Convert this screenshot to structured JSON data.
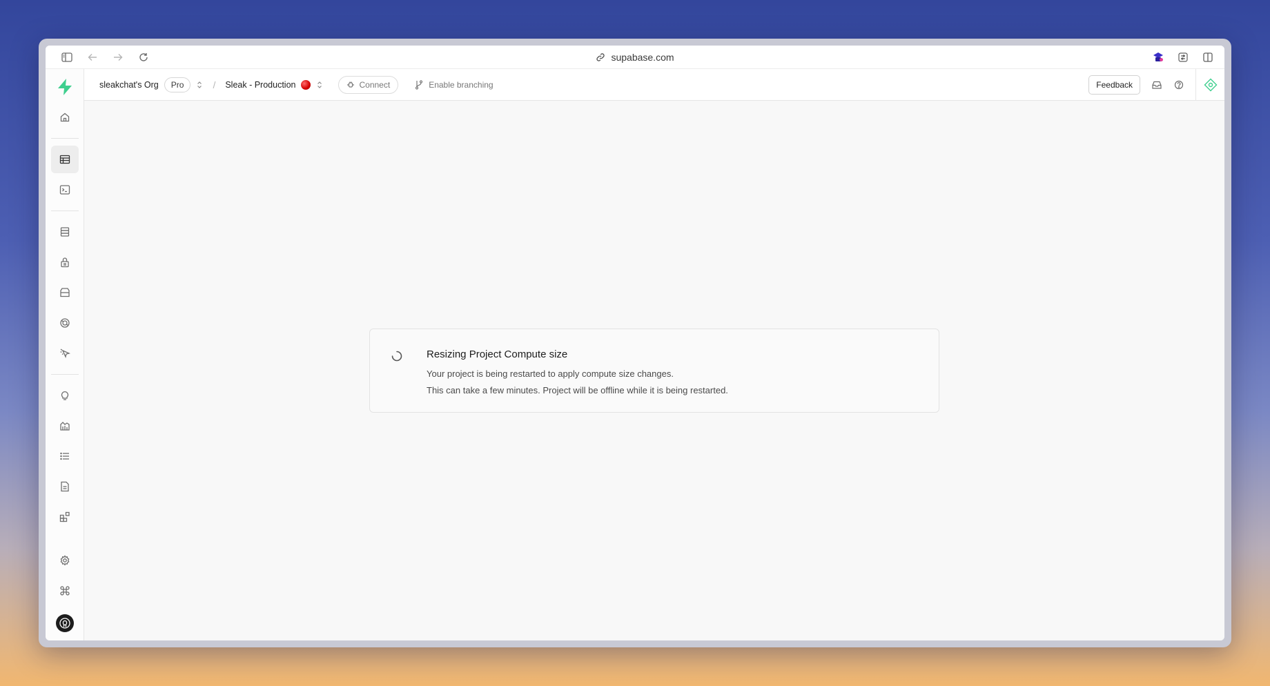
{
  "browser": {
    "url": "supabase.com"
  },
  "topbar": {
    "org_name": "sleakchat's Org",
    "plan_badge": "Pro",
    "project_name": "Sleak - Production",
    "connect_label": "Connect",
    "branching_label": "Enable branching",
    "feedback_label": "Feedback"
  },
  "sidebar": {
    "items": [
      {
        "icon": "home-icon"
      },
      {
        "icon": "table-editor-icon",
        "active": true
      },
      {
        "icon": "sql-editor-icon"
      },
      {
        "icon": "database-icon"
      },
      {
        "icon": "auth-lock-icon"
      },
      {
        "icon": "storage-icon"
      },
      {
        "icon": "realtime-icon"
      },
      {
        "icon": "edge-functions-icon"
      },
      {
        "icon": "advisors-bulb-icon"
      },
      {
        "icon": "reports-icon"
      },
      {
        "icon": "logs-icon"
      },
      {
        "icon": "api-docs-icon"
      },
      {
        "icon": "integrations-icon"
      },
      {
        "icon": "settings-gear-icon"
      },
      {
        "icon": "command-icon"
      }
    ]
  },
  "status_card": {
    "title": "Resizing Project Compute size",
    "line1": "Your project is being restarted to apply compute size changes.",
    "line2": "This can take a few minutes. Project will be offline while it is being restarted."
  },
  "colors": {
    "brand": "#3ecf8e",
    "status_offline": "#d40000"
  }
}
